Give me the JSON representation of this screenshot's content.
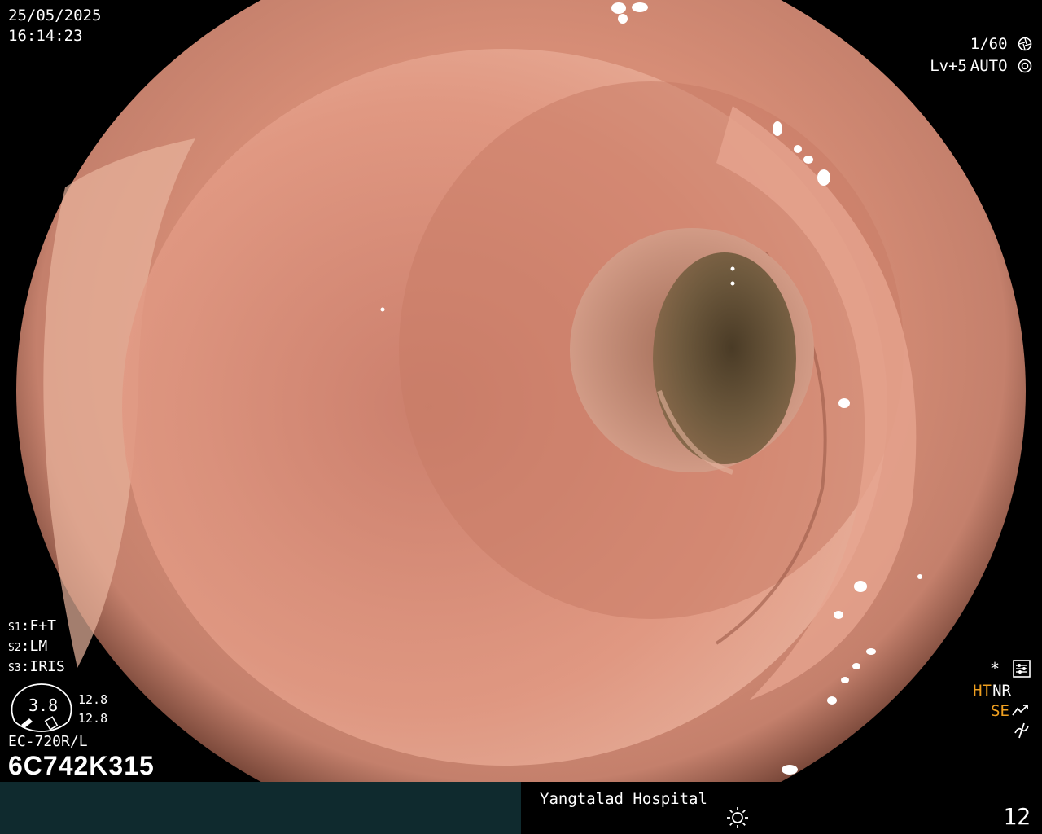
{
  "datetime": {
    "date": "25/05/2025",
    "time": "16:14:23"
  },
  "camera": {
    "shutter": "1/60",
    "level": "Lv+5",
    "mode": "AUTO"
  },
  "switches": [
    {
      "key": "S1",
      "value": "F+T"
    },
    {
      "key": "S2",
      "value": "LM"
    },
    {
      "key": "S3",
      "value": "IRIS"
    }
  ],
  "gauge": {
    "value": "3.8",
    "readout_top": "12.8",
    "readout_bottom": "12.8"
  },
  "scope": {
    "model": "EC-720R/L",
    "serial": "6C742K315"
  },
  "enhancement": {
    "star": "*",
    "ht": "HT",
    "nr": "NR",
    "se": "SE"
  },
  "footer": {
    "hospital": "Yangtalad Hospital",
    "counter": "12"
  },
  "icons": [
    "shutter-icon",
    "auto-mode-icon",
    "menu-settings-icon",
    "se-arrow-icon",
    "ne-icon",
    "light-source-icon"
  ],
  "colors": {
    "mucosa": "#d9876e",
    "orange_label": "#f0a020",
    "patient_panel": "#0f2a2e"
  }
}
